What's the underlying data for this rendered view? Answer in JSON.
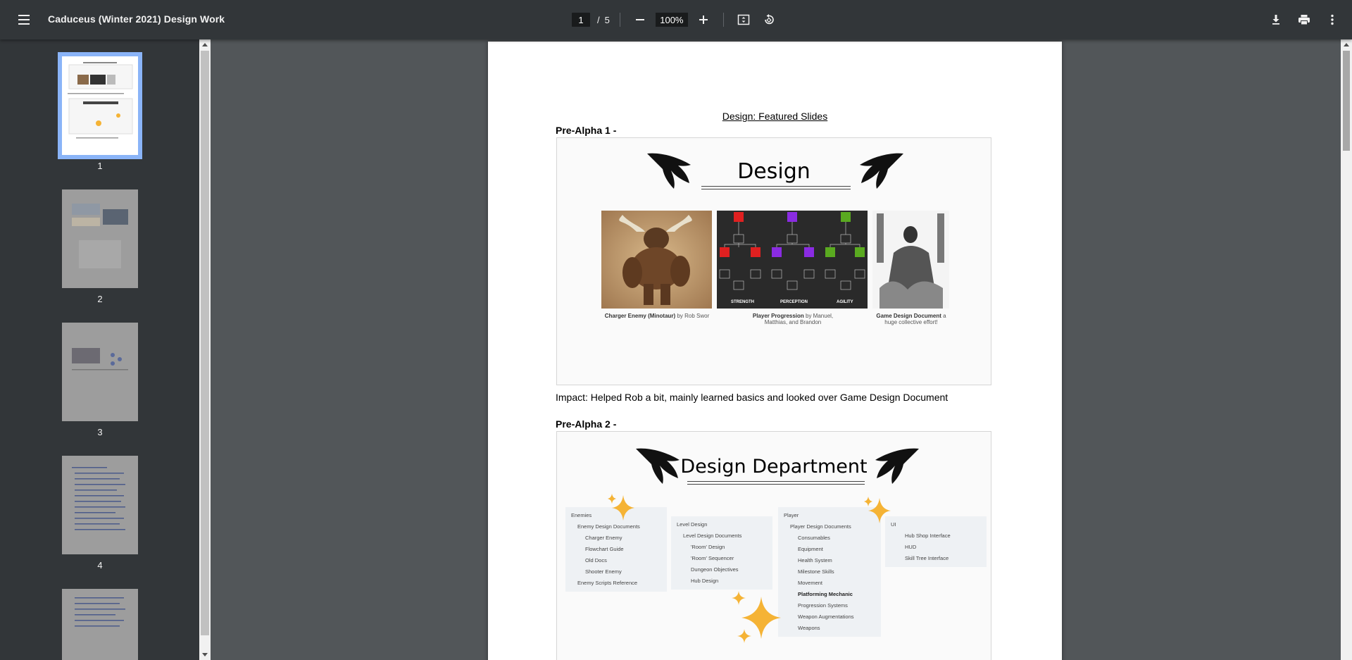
{
  "toolbar": {
    "title": "Caduceus (Winter 2021) Design Work",
    "current_page": "1",
    "page_separator": "/",
    "total_pages": "5",
    "zoom": "100%"
  },
  "thumbnails": [
    {
      "num": "1"
    },
    {
      "num": "2"
    },
    {
      "num": "3"
    },
    {
      "num": "4"
    }
  ],
  "page": {
    "heading": "Design: Featured Slides",
    "section1_label": "Pre-Alpha 1 -",
    "slide1": {
      "title": "Design",
      "captions": [
        {
          "bold": "Charger Enemy (Minotaur)",
          "rest": " by Rob Swor"
        },
        {
          "bold": "Player Progression",
          "rest": " by Manuel, Matthias, and Brandon"
        },
        {
          "bold": "Game Design Document",
          "rest": " a huge collective effort!"
        }
      ],
      "tree_labels": [
        "STRENGTH",
        "PERCEPTION",
        "AGILITY"
      ]
    },
    "impact": "Impact: Helped Rob a bit, mainly learned basics and looked over Game Design Document",
    "section2_label": "Pre-Alpha 2 -",
    "slide2": {
      "title": "Design Department",
      "col_enemies": [
        "Enemies",
        "Enemy Design Documents",
        "Charger Enemy",
        "Flowchart Guide",
        "Old Docs",
        "Shooter Enemy",
        "Enemy Scripts Reference"
      ],
      "col_level": [
        "Level Design",
        "Level Design Documents",
        "'Room' Design",
        "'Room' Sequencer",
        "Dungeon Objectives",
        "Hub Design"
      ],
      "col_player": [
        "Player",
        "Player Design Documents",
        "Consumables",
        "Equipment",
        "Health System",
        "Milestone Skills",
        "Movement",
        "Platforming Mechanic",
        "Progression Systems",
        "Weapon Augmentations",
        "Weapons"
      ],
      "col_ui": [
        "UI",
        "Hub Shop Interface",
        "HUD",
        "Skill Tree Interface"
      ]
    }
  },
  "colors": {
    "toolbar_bg": "#323639",
    "viewer_bg": "#525659",
    "thumb_active": "#8ab4f8",
    "star": "#f5b335"
  }
}
